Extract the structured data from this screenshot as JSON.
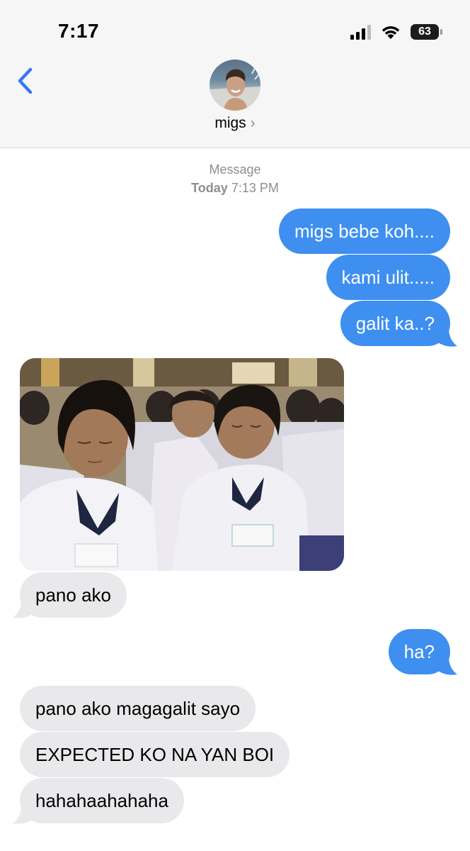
{
  "status_bar": {
    "time": "7:17",
    "battery": "63"
  },
  "header": {
    "contact_name": "migs",
    "chevron": "›"
  },
  "thread": {
    "service_label": "Message",
    "date_label": "Today",
    "time_label": "7:13 PM"
  },
  "messages": {
    "out1": "migs bebe koh....",
    "out2": "kami ulit.....",
    "out3": "galit ka..?",
    "in1": "pano ako",
    "out4": "ha?",
    "in2": "pano ako magagalit sayo",
    "in3": "EXPECTED KO NA YAN BOI",
    "in4": "hahahaahahaha"
  },
  "colors": {
    "outgoing": "#3e8ff0",
    "incoming": "#e9e9eb",
    "accent": "#3478f6"
  }
}
